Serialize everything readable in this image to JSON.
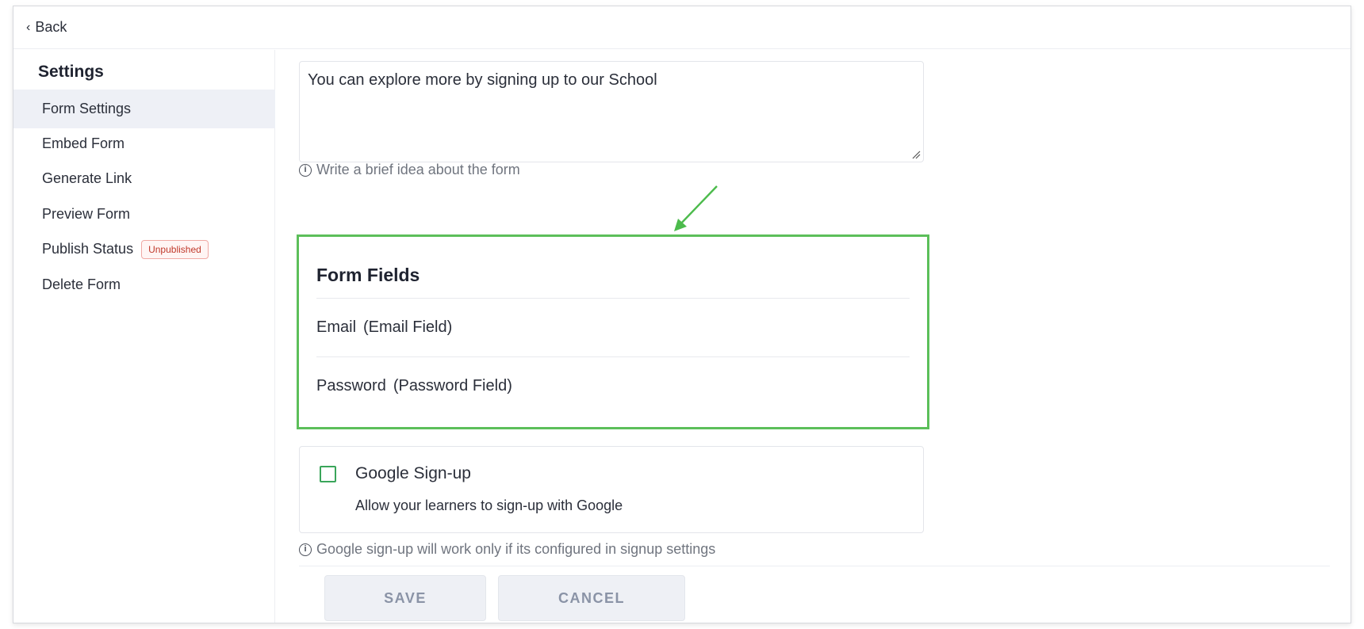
{
  "nav": {
    "back_label": "Back"
  },
  "sidebar": {
    "title": "Settings",
    "items": [
      {
        "label": "Form Settings"
      },
      {
        "label": "Embed Form"
      },
      {
        "label": "Generate Link"
      },
      {
        "label": "Preview Form"
      },
      {
        "label": "Publish Status",
        "badge": "Unpublished"
      },
      {
        "label": "Delete Form"
      }
    ]
  },
  "description": {
    "value": "You can explore more by signing up to our School",
    "hint": "Write a brief idea about the form"
  },
  "form_fields": {
    "title": "Form Fields",
    "fields": [
      {
        "label": "Email",
        "type": "(Email Field)"
      },
      {
        "label": "Password",
        "type": "(Password Field)"
      }
    ]
  },
  "google_signup": {
    "label": "Google Sign-up",
    "description": "Allow your learners to sign-up with Google",
    "checked": false,
    "hint": "Google sign-up will work only if its configured in signup settings"
  },
  "actions": {
    "save_label": "SAVE",
    "cancel_label": "CANCEL"
  },
  "colors": {
    "highlight_box": "#5cbf5a",
    "arrow": "#4cbb4c",
    "checkbox_border": "#3aa55a",
    "badge_text": "#c0392b"
  }
}
